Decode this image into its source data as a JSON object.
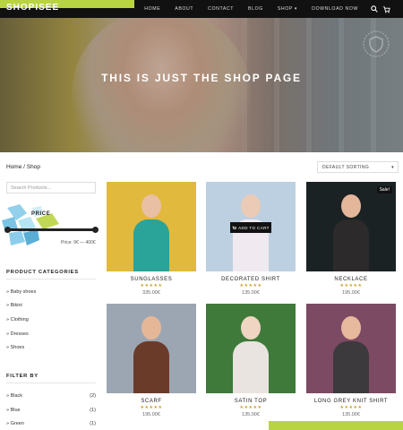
{
  "header": {
    "logo": "SHOPISEE",
    "nav": [
      "HOME",
      "ABOUT",
      "CONTACT",
      "BLOG",
      "SHOP ▾",
      "DOWNLOAD NOW"
    ]
  },
  "hero": {
    "title": "THIS IS JUST THE SHOP PAGE"
  },
  "breadcrumb": "Home / Shop",
  "sort": {
    "selected": "DEFAULT SORTING"
  },
  "sidebar": {
    "search_placeholder": "Search Products...",
    "price_heading": "PRICE",
    "price_range": "Price: 9€ — 400€",
    "slider_low": 0.0,
    "slider_high": 1.0,
    "categories_heading": "PRODUCT CATEGORIES",
    "categories": [
      "Baby shoes",
      "Bikini",
      "Clothing",
      "Dresses",
      "Shoes"
    ],
    "filter_heading": "FILTER BY",
    "filters": [
      {
        "label": "Black",
        "count": "(2)"
      },
      {
        "label": "Blue",
        "count": "(1)"
      },
      {
        "label": "Green",
        "count": "(1)"
      }
    ]
  },
  "products": [
    {
      "name": "SUNGLASSES",
      "stars": "★★★★★",
      "price": "335.00€",
      "bg": "#e1b93d",
      "skin": "#e9c0a4",
      "top": "#2aa399"
    },
    {
      "name": "DECORATED SHIRT",
      "stars": "★★★★★",
      "price": "135.00€",
      "bg": "#bcd0e2",
      "skin": "#ebcab6",
      "top": "#f0eaf0",
      "add_to_cart": "ADD TO CART"
    },
    {
      "name": "NECKLACE",
      "stars": "★★★★★",
      "price": "195.00€",
      "bg": "#1a2224",
      "skin": "#e4b69a",
      "top": "#2c2a2a",
      "sale": "Sale!"
    },
    {
      "name": "SCARF",
      "stars": "★★★★★",
      "price": "195.00€",
      "bg": "#9ca6b3",
      "skin": "#e6b797",
      "top": "#6b3b2a"
    },
    {
      "name": "SATIN TOP",
      "stars": "★★★★★",
      "price": "135.00€",
      "bg": "#3f7a3a",
      "skin": "#efd5c2",
      "top": "#e9e4df"
    },
    {
      "name": "LONG GREY KNIT SHIRT",
      "stars": "★★★★★",
      "price": "135.00€",
      "bg": "#7d4a63",
      "skin": "#e7b99d",
      "top": "#3c3a3c"
    }
  ],
  "colors": {
    "accent": "#b9d443",
    "dark": "#111111"
  }
}
